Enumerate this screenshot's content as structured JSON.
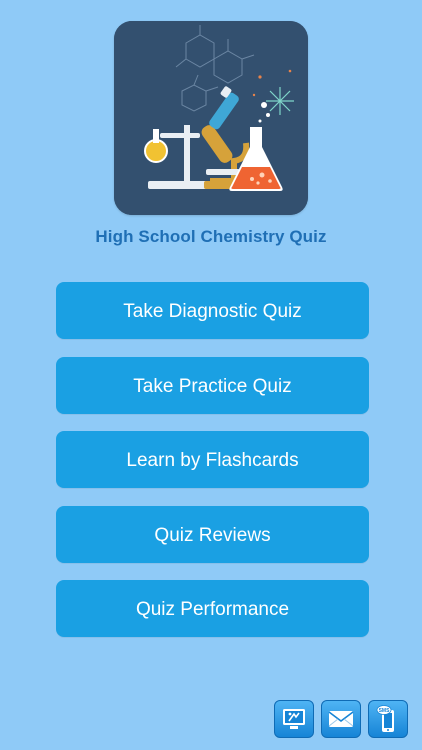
{
  "app": {
    "title": "High School Chemistry Quiz",
    "icon_name": "chemistry-lab-icon"
  },
  "menu": {
    "items": [
      {
        "label": "Take Diagnostic Quiz"
      },
      {
        "label": "Take Practice Quiz"
      },
      {
        "label": "Learn by Flashcards"
      },
      {
        "label": "Quiz Reviews"
      },
      {
        "label": "Quiz Performance"
      }
    ]
  },
  "share_bar": {
    "items": [
      {
        "icon": "share-app-icon"
      },
      {
        "icon": "mail-icon"
      },
      {
        "icon": "sms-icon",
        "label": "SMS"
      }
    ]
  },
  "colors": {
    "background": "#8fcaf7",
    "button": "#1aa0e3",
    "button_text": "#ffffff",
    "title_text": "#1f6fb5",
    "icon_bg": "#33506f"
  }
}
